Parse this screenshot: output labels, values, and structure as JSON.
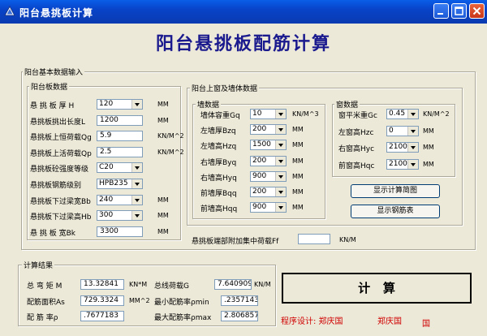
{
  "window": {
    "title": "阳台悬挑板计算"
  },
  "heading": "阳台悬挑板配筋计算",
  "basic_group": {
    "label": "阳台基本数据输入"
  },
  "slab_group": {
    "label": "阳台板数据",
    "rows": [
      {
        "label": "悬 挑 板 厚 H",
        "value": "120",
        "unit": "MM"
      },
      {
        "label": "悬挑板挑出长度L",
        "value": "1200",
        "unit": "MM"
      },
      {
        "label": "悬挑板上恒荷载Qg",
        "value": "5.9",
        "unit": "KN/M^2"
      },
      {
        "label": "悬挑板上活荷载Qp",
        "value": "2.5",
        "unit": "KN/M^2"
      },
      {
        "label": "悬挑板砼强度等级",
        "value": "C20",
        "unit": ""
      },
      {
        "label": "悬挑板钢筋级别",
        "value": "HPB235",
        "unit": ""
      },
      {
        "label": "悬挑板下过梁宽Bb",
        "value": "240",
        "unit": "MM"
      },
      {
        "label": "悬挑板下过梁高Hb",
        "value": "300",
        "unit": "MM"
      },
      {
        "label": "悬 挑 板 宽Bk",
        "value": "3300",
        "unit": "MM"
      }
    ]
  },
  "window_wall_group": {
    "label": "阳台上窗及墙体数据"
  },
  "wall_group": {
    "label": "墙数据",
    "rows": [
      {
        "label": "墙体容重Gq",
        "value": "10",
        "unit": "KN/M^3"
      },
      {
        "label": "左墙厚Bzq",
        "value": "200",
        "unit": "MM"
      },
      {
        "label": "左墙高Hzq",
        "value": "1500",
        "unit": "MM"
      },
      {
        "label": "右墙厚Byq",
        "value": "200",
        "unit": "MM"
      },
      {
        "label": "右墙高Hyq",
        "value": "900",
        "unit": "MM"
      },
      {
        "label": "前墙厚Bqq",
        "value": "200",
        "unit": "MM"
      },
      {
        "label": "前墙高Hqq",
        "value": "900",
        "unit": "MM"
      }
    ]
  },
  "win_group": {
    "label": "窗数据",
    "rows": [
      {
        "label": "窗平米重Gc",
        "value": "0.45",
        "unit": "KN/M^2"
      },
      {
        "label": "左窗高Hzc",
        "value": "0",
        "unit": "MM"
      },
      {
        "label": "右窗高Hyc",
        "value": "2100",
        "unit": "MM"
      },
      {
        "label": "前窗高Hqc",
        "value": "2100",
        "unit": "MM"
      }
    ]
  },
  "buttons": {
    "show_diagram": "显示计算简图",
    "show_rebar": "显示钢筋表",
    "calculate": "计   算"
  },
  "end_load": {
    "label": "悬挑板端部附加集中荷载Ff",
    "value": "",
    "unit": "KN/M"
  },
  "results": {
    "label": "计算结果",
    "moment": {
      "label": "总 弯 矩 M",
      "value": "13.32841",
      "unit": "KN*M"
    },
    "steel_area": {
      "label": "配筋面积As",
      "value": "729.3324",
      "unit": "MM^2"
    },
    "ratio": {
      "label": "配 筋 率ρ",
      "value": ".7677183"
    },
    "line_load": {
      "label": "总线荷载G",
      "value": "7.640909",
      "unit": "KN/M"
    },
    "min_ratio": {
      "label": "最小配筋率ρmin",
      "value": ".2357143"
    },
    "max_ratio": {
      "label": "最大配筋率ρmax",
      "value": "2.806857"
    }
  },
  "credits": {
    "designer": "程序设计: 郑庆国",
    "name2": "郑庆国",
    "name3": "国"
  }
}
